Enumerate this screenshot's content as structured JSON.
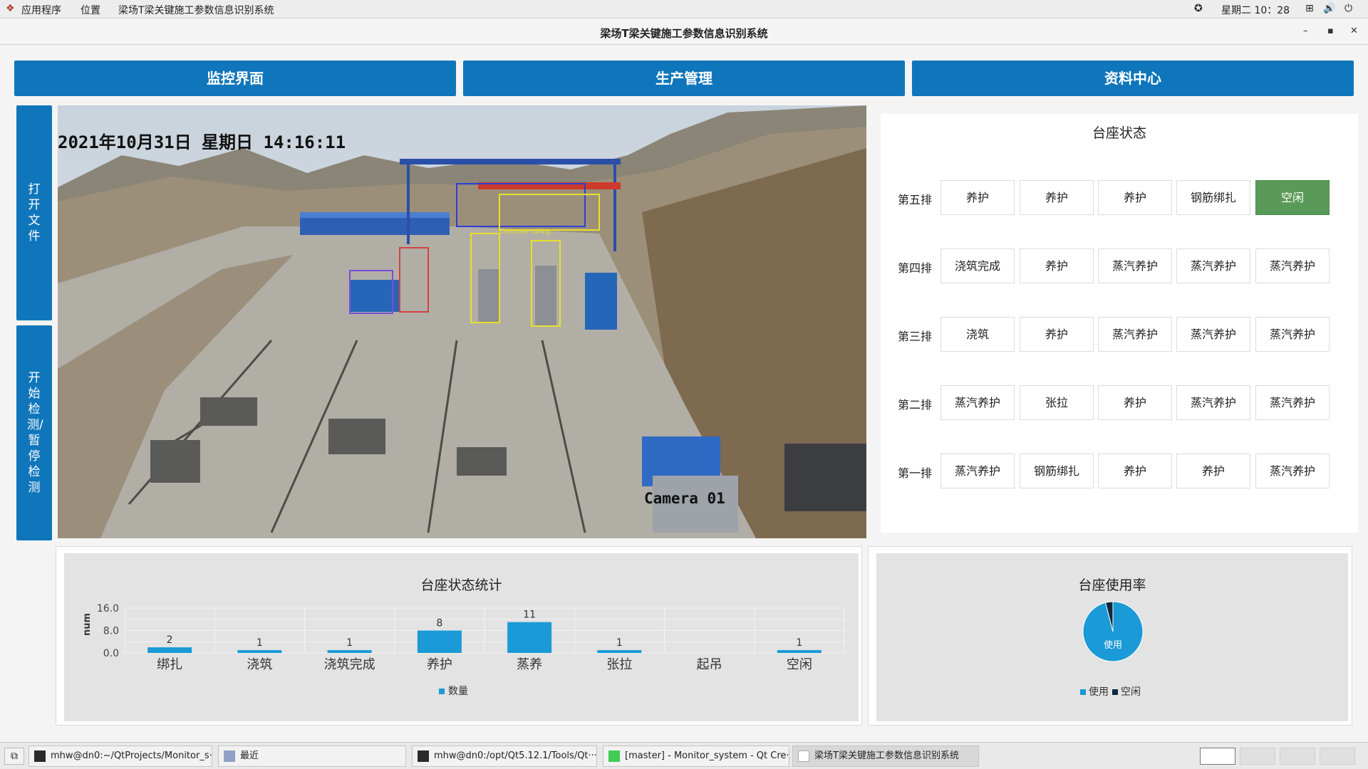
{
  "topbar": {
    "apps": "应用程序",
    "places": "位置",
    "window": "梁场T梁关键施工参数信息识别系统",
    "clock": "星期二 10：28"
  },
  "window": {
    "title": "梁场T梁关键施工参数信息识别系统",
    "min": "–",
    "max": "▪",
    "close": "✕"
  },
  "nav": {
    "monitor": "监控界面",
    "production": "生产管理",
    "documents": "资料中心"
  },
  "side": {
    "open_file": "打开文件",
    "detect": "开始检测/暂停检测"
  },
  "video": {
    "timestamp": "2021年10月31日 星期日 14:16:11",
    "camera": "Camera 01",
    "detection_label": "Concrete curing"
  },
  "status": {
    "title": "台座状态",
    "rows": [
      {
        "label": "第五排",
        "cells": [
          "养护",
          "养护",
          "养护",
          "钢筋绑扎",
          "空闲"
        ]
      },
      {
        "label": "第四排",
        "cells": [
          "浇筑完成",
          "养护",
          "蒸汽养护",
          "蒸汽养护",
          "蒸汽养护"
        ]
      },
      {
        "label": "第三排",
        "cells": [
          "浇筑",
          "养护",
          "蒸汽养护",
          "蒸汽养护",
          "蒸汽养护"
        ]
      },
      {
        "label": "第二排",
        "cells": [
          "蒸汽养护",
          "张拉",
          "养护",
          "蒸汽养护",
          "蒸汽养护"
        ]
      },
      {
        "label": "第一排",
        "cells": [
          "蒸汽养护",
          "钢筋绑扎",
          "养护",
          "养护",
          "蒸汽养护"
        ]
      }
    ],
    "idle_color": "#5a9a58"
  },
  "chart_data": [
    {
      "type": "bar",
      "title": "台座状态统计",
      "categories": [
        "绑扎",
        "浇筑",
        "浇筑完成",
        "养护",
        "蒸养",
        "张拉",
        "起吊",
        "空闲"
      ],
      "series": [
        {
          "name": "数量",
          "values": [
            2,
            1,
            1,
            8,
            11,
            1,
            0,
            1
          ]
        }
      ],
      "data_labels": [
        "2",
        "1",
        "1",
        "8",
        "11",
        "1",
        "",
        "1"
      ],
      "ylabel": "num",
      "yticks": [
        "0.0",
        "8.0",
        "16.0"
      ],
      "ylim": [
        0,
        16
      ],
      "grid": true,
      "legend": "bottom",
      "color": "#1a9ad6"
    },
    {
      "type": "pie",
      "title": "台座使用率",
      "categories": [
        "使用",
        "空闲"
      ],
      "values": [
        24,
        1
      ],
      "slice_label": "使用",
      "colors": [
        "#1a9ad6",
        "#0e2840"
      ],
      "legend": "bottom"
    }
  ],
  "taskbar": {
    "tasks": [
      "mhw@dn0:~/QtProjects/Monitor_s···",
      "最近",
      "mhw@dn0:/opt/Qt5.12.1/Tools/Qt···",
      "[master] - Monitor_system - Qt Cre···",
      "梁场T梁关键施工参数信息识别系统"
    ]
  }
}
